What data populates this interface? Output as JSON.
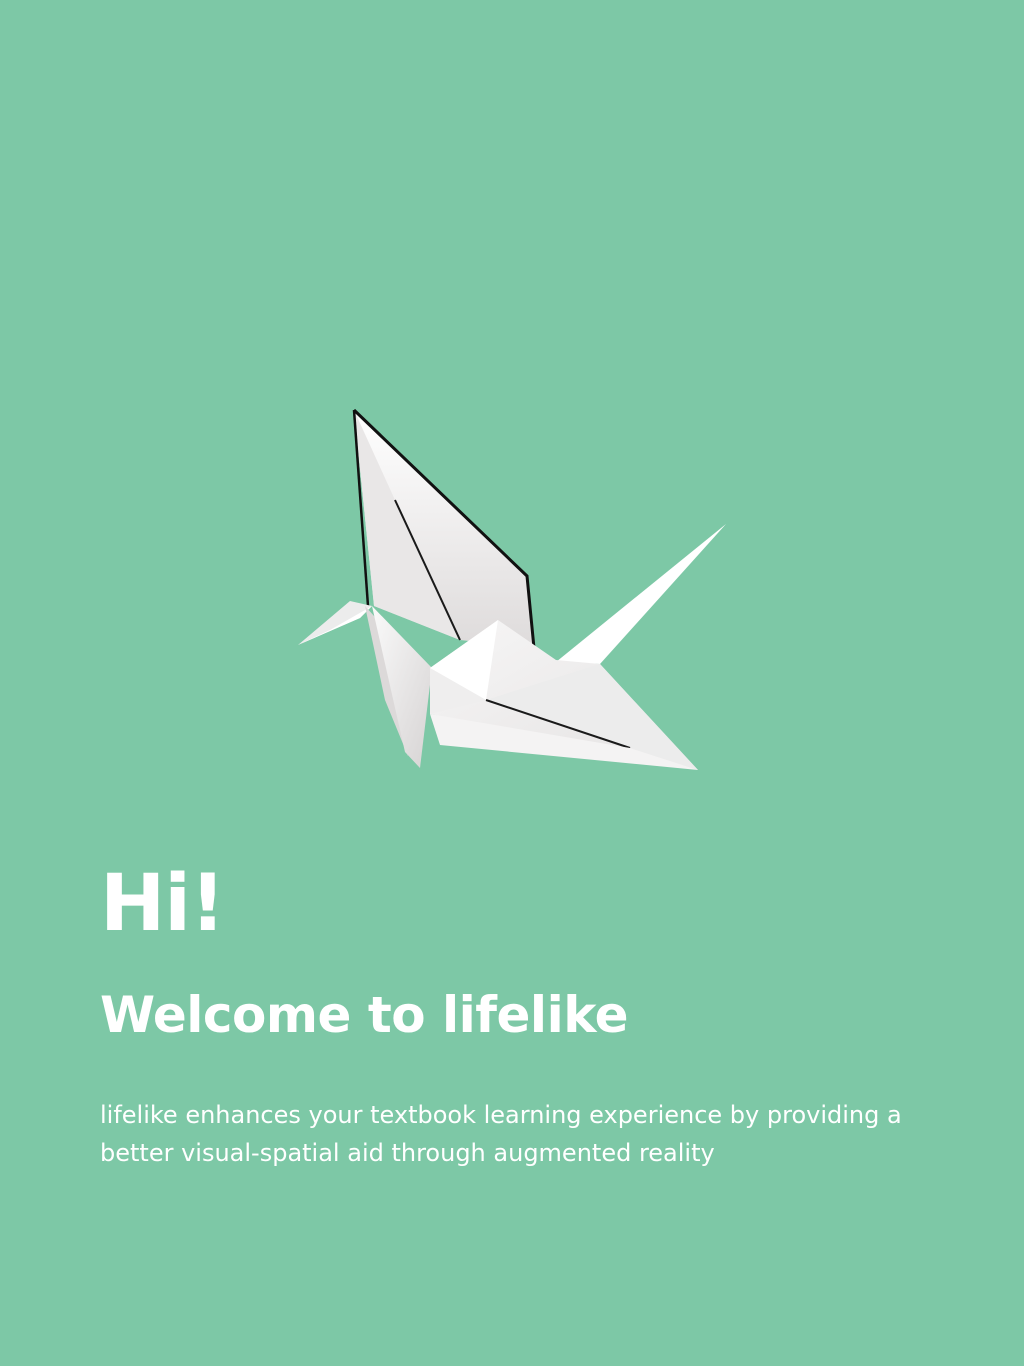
{
  "colors": {
    "background": "#7dc8a6",
    "text": "#ffffff",
    "crane_paper": "#ffffff",
    "crane_shadow": "#d8d5d5",
    "crane_edge": "#111111"
  },
  "hero": {
    "illustration": "origami-crane-icon",
    "greeting": "Hi!",
    "welcome": "Welcome to lifelike",
    "description": "lifelike enhances your textbook learning experience by providing a better visual-spatial aid through augmented reality"
  }
}
